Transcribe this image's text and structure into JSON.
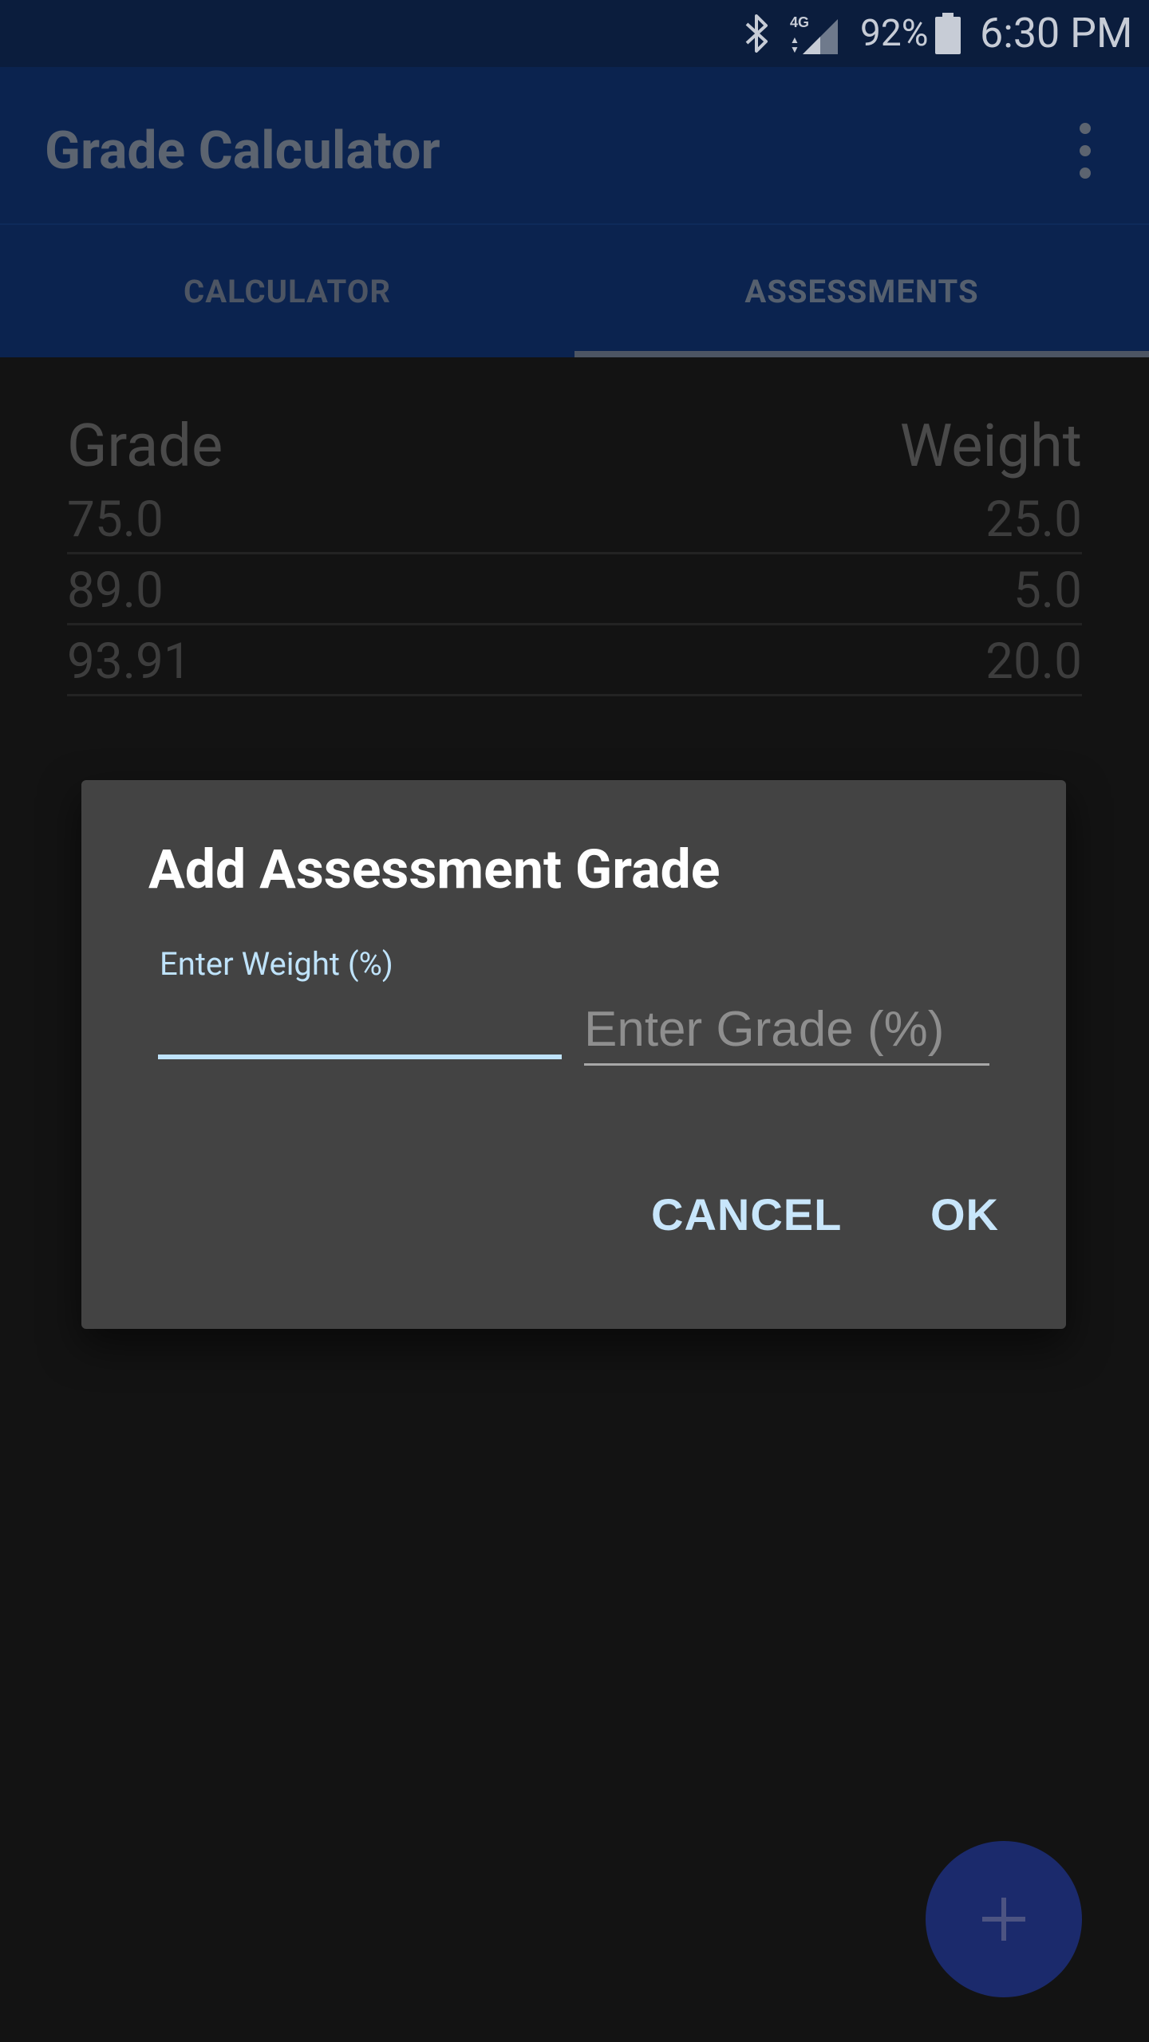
{
  "status_bar": {
    "network": "4G",
    "battery": "92%",
    "time": "6:30 PM"
  },
  "app_bar": {
    "title": "Grade Calculator"
  },
  "tabs": [
    {
      "label": "CALCULATOR",
      "selected": false
    },
    {
      "label": "ASSESSMENTS",
      "selected": true
    }
  ],
  "table": {
    "headers": {
      "grade": "Grade",
      "weight": "Weight"
    },
    "rows": [
      {
        "grade": "75.0",
        "weight": "25.0"
      },
      {
        "grade": "89.0",
        "weight": "5.0"
      },
      {
        "grade": "93.91",
        "weight": "20.0"
      }
    ]
  },
  "dialog": {
    "title": "Add Assessment Grade",
    "weight_label": "Enter Weight (%)",
    "weight_value": "",
    "grade_placeholder": "Enter Grade (%)",
    "grade_value": "",
    "cancel_label": "CANCEL",
    "ok_label": "OK"
  },
  "colors": {
    "accent": "#bfe3fb",
    "primary_dimmed": "#0b234f",
    "fab": "#1b2a6c"
  }
}
